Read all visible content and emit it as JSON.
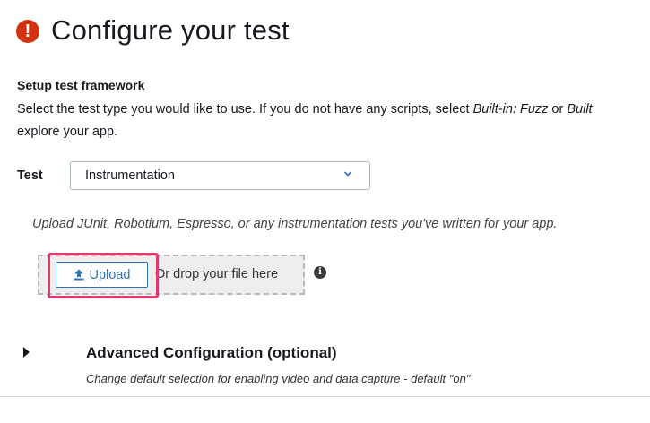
{
  "header": {
    "title": "Configure your test",
    "alert_icon": "exclamation-circle-icon",
    "alert_glyph": "!",
    "alert_color": "#d13212"
  },
  "framework": {
    "heading": "Setup test framework",
    "desc_part1": "Select the test type you would like to use. If you do not have any scripts, select ",
    "desc_em1": "Built-in: Fuzz",
    "desc_part2": " or ",
    "desc_em2": "Built",
    "desc_part3": "explore your app."
  },
  "test": {
    "label": "Test",
    "selected": "Instrumentation",
    "dropdown_icon": "chevron-down-icon"
  },
  "upload": {
    "hint": "Upload JUnit, Robotium, Espresso, or any instrumentation tests you've written for your app.",
    "button_label": "Upload",
    "button_icon": "upload-icon",
    "drop_text": "Or drop your file here",
    "info_icon": "info-icon",
    "info_glyph": "i",
    "highlight_color": "#e6396b",
    "accent_color": "#2e73b8"
  },
  "advanced": {
    "title": "Advanced Configuration (optional)",
    "description": "Change default selection for enabling video and data capture - default \"on\"",
    "toggle_icon": "caret-right-icon"
  }
}
